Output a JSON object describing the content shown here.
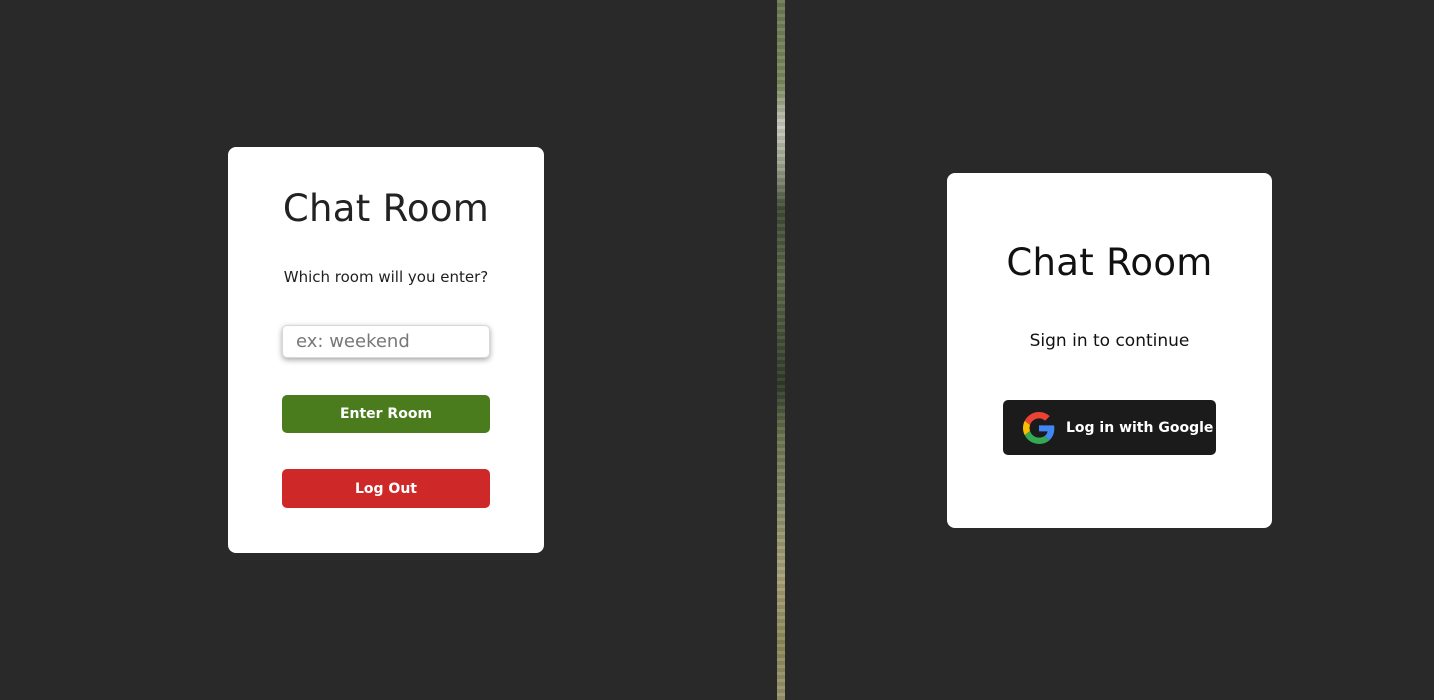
{
  "room_screen": {
    "title": "Chat Room",
    "prompt": "Which room will you enter?",
    "room_input": {
      "placeholder": "ex: weekend",
      "value": ""
    },
    "enter_button_label": "Enter Room",
    "logout_button_label": "Log Out"
  },
  "login_screen": {
    "title": "Chat Room",
    "subtitle": "Sign in to continue",
    "google_button_label": "Log in with Google",
    "google_icon": "google-g-icon"
  },
  "colors": {
    "page_background": "#292929",
    "card_background": "#ffffff",
    "enter_button": "#4a7c1d",
    "logout_button": "#cf2828",
    "google_button": "#1b1b1b"
  }
}
